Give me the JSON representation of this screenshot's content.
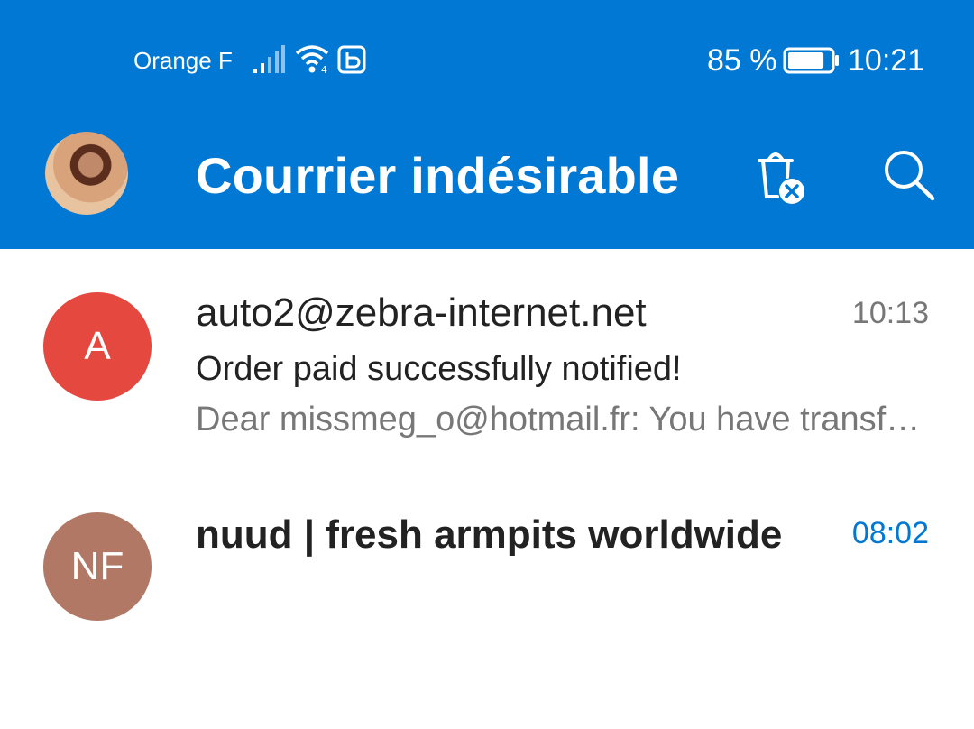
{
  "status_bar": {
    "carrier": "Orange F",
    "battery_percent": "85 %",
    "battery_level": 0.85,
    "time": "10:21",
    "icons": [
      "signal-icon",
      "wifi-icon",
      "b-status-icon",
      "battery-icon"
    ]
  },
  "header": {
    "title": "Courrier indésirable",
    "actions": [
      "empty-junk-icon",
      "search-icon"
    ]
  },
  "colors": {
    "accent": "#0078d4",
    "avatar_a": "#e5483e",
    "avatar_nf": "#b07865"
  },
  "messages": [
    {
      "avatar_initials": "A",
      "sender": "auto2@zebra-internet.net",
      "time": "10:13",
      "subject": "Order paid successfully notified!",
      "preview": "Dear missmeg_o@hotmail.fr: You have transferred",
      "unread": false
    },
    {
      "avatar_initials": "NF",
      "sender": "nuud | fresh armpits worldwide",
      "time": "08:02",
      "unread": true
    }
  ]
}
